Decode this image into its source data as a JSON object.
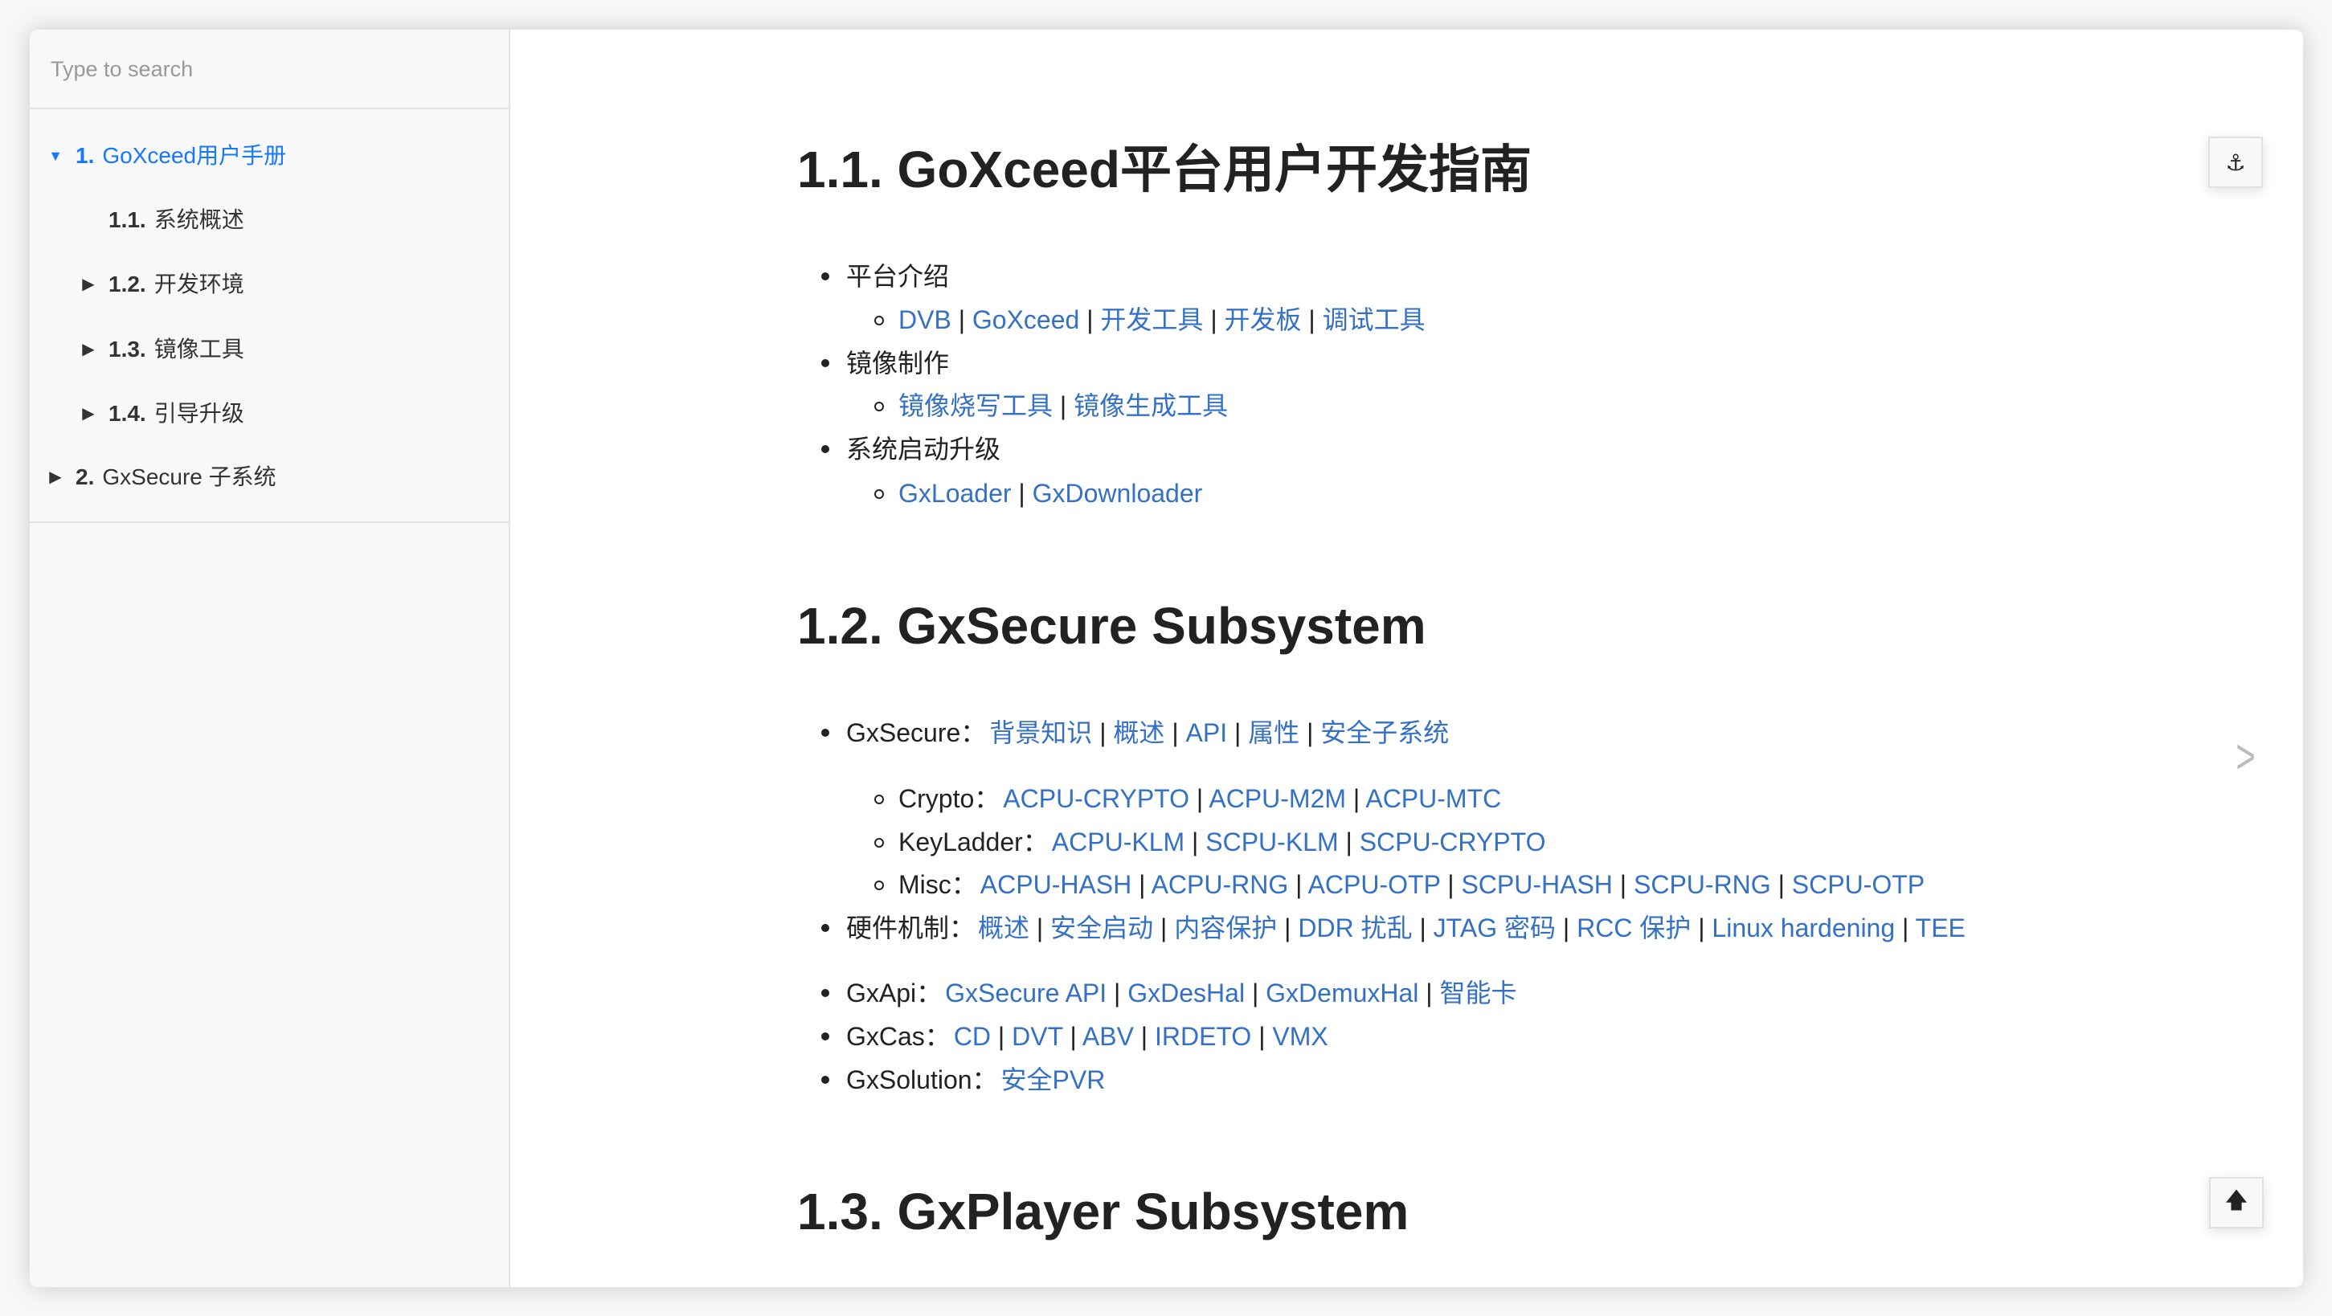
{
  "search": {
    "placeholder": "Type to search"
  },
  "sidebar": {
    "items": [
      {
        "num": "1.",
        "label": "GoXceed用户手册",
        "level": 1,
        "state": "expanded",
        "active": true
      },
      {
        "num": "1.1.",
        "label": "系统概述",
        "level": 2,
        "state": "leaf",
        "active": false
      },
      {
        "num": "1.2.",
        "label": "开发环境",
        "level": 2,
        "state": "collapsed",
        "active": false
      },
      {
        "num": "1.3.",
        "label": "镜像工具",
        "level": 2,
        "state": "collapsed",
        "active": false
      },
      {
        "num": "1.4.",
        "label": "引导升级",
        "level": 2,
        "state": "collapsed",
        "active": false
      },
      {
        "num": "2.",
        "label": "GxSecure 子系统",
        "level": 1,
        "state": "collapsed",
        "active": false
      }
    ]
  },
  "content": [
    {
      "type": "heading",
      "text": "1.1. GoXceed平台用户开发指南"
    },
    {
      "type": "item",
      "level": 1,
      "label": "平台介绍",
      "links": []
    },
    {
      "type": "item",
      "level": 2,
      "label": "",
      "links": [
        "DVB",
        "GoXceed",
        "开发工具",
        "开发板",
        "调试工具"
      ]
    },
    {
      "type": "item",
      "level": 1,
      "label": "镜像制作",
      "links": []
    },
    {
      "type": "item",
      "level": 2,
      "label": "",
      "links": [
        "镜像烧写工具",
        "镜像生成工具"
      ]
    },
    {
      "type": "item",
      "level": 1,
      "label": "系统启动升级",
      "links": []
    },
    {
      "type": "item",
      "level": 2,
      "label": "",
      "links": [
        "GxLoader",
        "GxDownloader"
      ]
    },
    {
      "type": "heading",
      "text": "1.2. GxSecure Subsystem"
    },
    {
      "type": "item",
      "level": 1,
      "label": "GxSecure：",
      "links": [
        "背景知识",
        "概述",
        "API",
        "属性",
        "安全子系统"
      ]
    },
    {
      "type": "item",
      "level": 2,
      "label": "Crypto：",
      "links": [
        "ACPU-CRYPTO",
        "ACPU-M2M",
        "ACPU-MTC"
      ]
    },
    {
      "type": "item",
      "level": 2,
      "label": "KeyLadder：",
      "links": [
        "ACPU-KLM",
        "SCPU-KLM",
        "SCPU-CRYPTO"
      ]
    },
    {
      "type": "item",
      "level": 2,
      "label": "Misc：",
      "links": [
        "ACPU-HASH",
        "ACPU-RNG",
        "ACPU-OTP",
        "SCPU-HASH",
        "SCPU-RNG",
        "SCPU-OTP"
      ]
    },
    {
      "type": "item",
      "level": 1,
      "label": "硬件机制：",
      "links": [
        "概述",
        "安全启动",
        "内容保护",
        "DDR 扰乱",
        "JTAG 密码",
        "RCC 保护",
        "Linux hardening",
        "TEE"
      ]
    },
    {
      "type": "item",
      "level": 1,
      "label": "GxApi：",
      "links": [
        "GxSecure API",
        "GxDesHal",
        "GxDemuxHal",
        "智能卡"
      ]
    },
    {
      "type": "item",
      "level": 1,
      "label": "GxCas：",
      "links": [
        "CD",
        "DVT",
        "ABV",
        "IRDETO",
        "VMX"
      ]
    },
    {
      "type": "item",
      "level": 1,
      "label": "GxSolution：",
      "links": [
        "安全PVR"
      ]
    },
    {
      "type": "heading",
      "text": "1.3. GxPlayer Subsystem"
    }
  ],
  "buttons": {
    "anchor_icon": "anchor-icon",
    "top_icon": "arrow-up-icon",
    "next_icon": "chevron-right-icon"
  },
  "colors": {
    "link": "#3370c6",
    "active_nav": "#1677ff"
  }
}
